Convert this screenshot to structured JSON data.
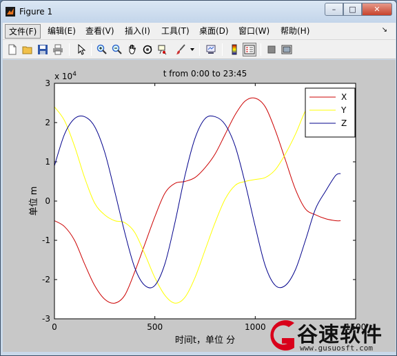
{
  "window": {
    "title": "Figure 1",
    "controls": {
      "minimize": "–",
      "maximize": "□",
      "close": "✕"
    }
  },
  "menubar": {
    "items": [
      {
        "label": "文件(F)"
      },
      {
        "label": "编辑(E)"
      },
      {
        "label": "查看(V)"
      },
      {
        "label": "插入(I)"
      },
      {
        "label": "工具(T)"
      },
      {
        "label": "桌面(D)"
      },
      {
        "label": "窗口(W)"
      },
      {
        "label": "帮助(H)"
      }
    ],
    "overflow_icon": "chevron-icon"
  },
  "toolbar": {
    "icons": [
      "new-figure-icon",
      "open-file-icon",
      "save-figure-icon",
      "print-figure-icon",
      "edit-plot-arrow-icon",
      "zoom-in-icon",
      "zoom-out-icon",
      "pan-hand-icon",
      "rotate-3d-icon",
      "data-cursor-icon",
      "brush-icon",
      "dropdown-icon",
      "link-plot-icon",
      "insert-colorbar-icon",
      "insert-legend-icon",
      "hide-plot-tools-icon",
      "show-plot-tools-icon"
    ]
  },
  "colors": {
    "x_series": "#cc0000",
    "y_series": "#ffff00",
    "z_series": "#00008b",
    "axes_bg": "#ffffff",
    "figure_bg": "#c8c8c8"
  },
  "chart_data": {
    "type": "line",
    "title": "t from 0:00 to 23:45",
    "xlabel": "时间t，单位 分",
    "ylabel": "单位 m",
    "y_exponent": "x 10",
    "y_exponent_power": "4",
    "xlim": [
      0,
      1500
    ],
    "ylim": [
      -3,
      3
    ],
    "xticks": [
      "0",
      "500",
      "1000",
      "1500"
    ],
    "yticks": [
      "3",
      "2",
      "1",
      "0",
      "-1",
      "-2",
      "-3"
    ],
    "legend_position": "top-right",
    "grid": false,
    "series": [
      {
        "name": "X",
        "color": "#cc0000",
        "x": [
          0,
          50,
          100,
          150,
          200,
          250,
          300,
          350,
          400,
          450,
          500,
          550,
          600,
          650,
          700,
          750,
          800,
          850,
          900,
          950,
          1000,
          1050,
          1100,
          1150,
          1200,
          1250,
          1300,
          1350,
          1400,
          1425
        ],
        "y": [
          -0.5,
          -0.65,
          -1.0,
          -1.6,
          -2.15,
          -2.5,
          -2.6,
          -2.4,
          -1.8,
          -1.1,
          -0.4,
          0.2,
          0.45,
          0.5,
          0.6,
          0.85,
          1.2,
          1.7,
          2.2,
          2.55,
          2.62,
          2.4,
          1.8,
          1.05,
          0.3,
          -0.2,
          -0.35,
          -0.45,
          -0.5,
          -0.5
        ]
      },
      {
        "name": "Y",
        "color": "#ffff00",
        "x": [
          0,
          50,
          100,
          150,
          200,
          250,
          300,
          350,
          400,
          450,
          500,
          550,
          600,
          650,
          700,
          750,
          800,
          850,
          900,
          950,
          1000,
          1050,
          1100,
          1150,
          1200,
          1250,
          1300
        ],
        "y": [
          2.4,
          2.05,
          1.4,
          0.6,
          -0.05,
          -0.35,
          -0.5,
          -0.55,
          -0.8,
          -1.35,
          -1.95,
          -2.4,
          -2.6,
          -2.45,
          -1.95,
          -1.25,
          -0.55,
          0.05,
          0.4,
          0.5,
          0.55,
          0.6,
          0.8,
          1.2,
          1.7,
          2.3,
          2.7
        ]
      },
      {
        "name": "Z",
        "color": "#00008b",
        "x": [
          0,
          50,
          100,
          150,
          200,
          250,
          300,
          350,
          400,
          450,
          500,
          550,
          600,
          650,
          700,
          750,
          800,
          850,
          900,
          950,
          1000,
          1050,
          1100,
          1150,
          1200,
          1250,
          1300,
          1350,
          1400,
          1425
        ],
        "y": [
          0.9,
          1.7,
          2.1,
          2.15,
          1.9,
          1.25,
          0.25,
          -0.8,
          -1.7,
          -2.15,
          -2.15,
          -1.6,
          -0.55,
          0.65,
          1.6,
          2.1,
          2.15,
          1.95,
          1.4,
          0.45,
          -0.65,
          -1.65,
          -2.15,
          -2.15,
          -1.75,
          -1.0,
          -0.2,
          0.25,
          0.65,
          0.7
        ]
      }
    ]
  },
  "watermark": {
    "name": "谷速软件",
    "url": "www.gusuosft.com"
  }
}
